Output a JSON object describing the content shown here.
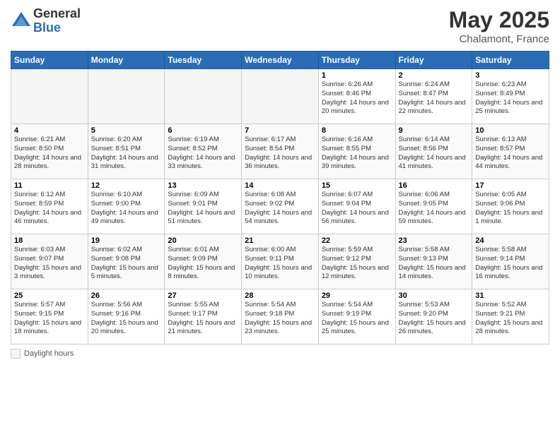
{
  "header": {
    "logo_general": "General",
    "logo_blue": "Blue",
    "month_year": "May 2025",
    "location": "Chalamont, France"
  },
  "days_of_week": [
    "Sunday",
    "Monday",
    "Tuesday",
    "Wednesday",
    "Thursday",
    "Friday",
    "Saturday"
  ],
  "legend_label": "Daylight hours",
  "weeks": [
    [
      {
        "day": "",
        "empty": true
      },
      {
        "day": "",
        "empty": true
      },
      {
        "day": "",
        "empty": true
      },
      {
        "day": "",
        "empty": true
      },
      {
        "day": "1",
        "sunrise": "6:26 AM",
        "sunset": "8:46 PM",
        "daylight": "14 hours and 20 minutes."
      },
      {
        "day": "2",
        "sunrise": "6:24 AM",
        "sunset": "8:47 PM",
        "daylight": "14 hours and 22 minutes."
      },
      {
        "day": "3",
        "sunrise": "6:23 AM",
        "sunset": "8:49 PM",
        "daylight": "14 hours and 25 minutes."
      }
    ],
    [
      {
        "day": "4",
        "sunrise": "6:21 AM",
        "sunset": "8:50 PM",
        "daylight": "14 hours and 28 minutes."
      },
      {
        "day": "5",
        "sunrise": "6:20 AM",
        "sunset": "8:51 PM",
        "daylight": "14 hours and 31 minutes."
      },
      {
        "day": "6",
        "sunrise": "6:19 AM",
        "sunset": "8:52 PM",
        "daylight": "14 hours and 33 minutes."
      },
      {
        "day": "7",
        "sunrise": "6:17 AM",
        "sunset": "8:54 PM",
        "daylight": "14 hours and 36 minutes."
      },
      {
        "day": "8",
        "sunrise": "6:16 AM",
        "sunset": "8:55 PM",
        "daylight": "14 hours and 39 minutes."
      },
      {
        "day": "9",
        "sunrise": "6:14 AM",
        "sunset": "8:56 PM",
        "daylight": "14 hours and 41 minutes."
      },
      {
        "day": "10",
        "sunrise": "6:13 AM",
        "sunset": "8:57 PM",
        "daylight": "14 hours and 44 minutes."
      }
    ],
    [
      {
        "day": "11",
        "sunrise": "6:12 AM",
        "sunset": "8:59 PM",
        "daylight": "14 hours and 46 minutes."
      },
      {
        "day": "12",
        "sunrise": "6:10 AM",
        "sunset": "9:00 PM",
        "daylight": "14 hours and 49 minutes."
      },
      {
        "day": "13",
        "sunrise": "6:09 AM",
        "sunset": "9:01 PM",
        "daylight": "14 hours and 51 minutes."
      },
      {
        "day": "14",
        "sunrise": "6:08 AM",
        "sunset": "9:02 PM",
        "daylight": "14 hours and 54 minutes."
      },
      {
        "day": "15",
        "sunrise": "6:07 AM",
        "sunset": "9:04 PM",
        "daylight": "14 hours and 56 minutes."
      },
      {
        "day": "16",
        "sunrise": "6:06 AM",
        "sunset": "9:05 PM",
        "daylight": "14 hours and 59 minutes."
      },
      {
        "day": "17",
        "sunrise": "6:05 AM",
        "sunset": "9:06 PM",
        "daylight": "15 hours and 1 minute."
      }
    ],
    [
      {
        "day": "18",
        "sunrise": "6:03 AM",
        "sunset": "9:07 PM",
        "daylight": "15 hours and 3 minutes."
      },
      {
        "day": "19",
        "sunrise": "6:02 AM",
        "sunset": "9:08 PM",
        "daylight": "15 hours and 5 minutes."
      },
      {
        "day": "20",
        "sunrise": "6:01 AM",
        "sunset": "9:09 PM",
        "daylight": "15 hours and 8 minutes."
      },
      {
        "day": "21",
        "sunrise": "6:00 AM",
        "sunset": "9:11 PM",
        "daylight": "15 hours and 10 minutes."
      },
      {
        "day": "22",
        "sunrise": "5:59 AM",
        "sunset": "9:12 PM",
        "daylight": "15 hours and 12 minutes."
      },
      {
        "day": "23",
        "sunrise": "5:58 AM",
        "sunset": "9:13 PM",
        "daylight": "15 hours and 14 minutes."
      },
      {
        "day": "24",
        "sunrise": "5:58 AM",
        "sunset": "9:14 PM",
        "daylight": "15 hours and 16 minutes."
      }
    ],
    [
      {
        "day": "25",
        "sunrise": "5:57 AM",
        "sunset": "9:15 PM",
        "daylight": "15 hours and 18 minutes."
      },
      {
        "day": "26",
        "sunrise": "5:56 AM",
        "sunset": "9:16 PM",
        "daylight": "15 hours and 20 minutes."
      },
      {
        "day": "27",
        "sunrise": "5:55 AM",
        "sunset": "9:17 PM",
        "daylight": "15 hours and 21 minutes."
      },
      {
        "day": "28",
        "sunrise": "5:54 AM",
        "sunset": "9:18 PM",
        "daylight": "15 hours and 23 minutes."
      },
      {
        "day": "29",
        "sunrise": "5:54 AM",
        "sunset": "9:19 PM",
        "daylight": "15 hours and 25 minutes."
      },
      {
        "day": "30",
        "sunrise": "5:53 AM",
        "sunset": "9:20 PM",
        "daylight": "15 hours and 26 minutes."
      },
      {
        "day": "31",
        "sunrise": "5:52 AM",
        "sunset": "9:21 PM",
        "daylight": "15 hours and 28 minutes."
      }
    ]
  ]
}
